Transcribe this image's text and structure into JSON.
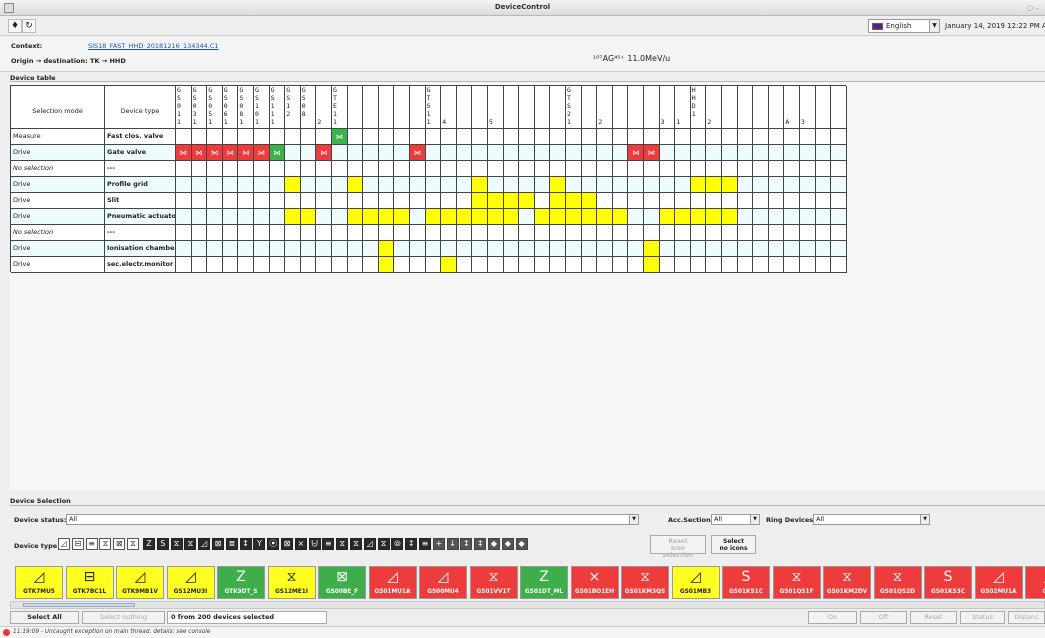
{
  "window": {
    "title": "DeviceControl"
  },
  "toolbar": {
    "language": "English",
    "datetime": "January 14, 2019 12:22 PM  Al"
  },
  "context": {
    "context_label": "Context:",
    "context_value": "SIS18_FAST_HHD_20181216_134344.C1",
    "origin_label": "Origin → destination: TK → HHD",
    "beam": "¹⁰⁷AG⁴⁵⁺ 11.0MeV/u"
  },
  "device_table": {
    "section_title": "Device table",
    "header": {
      "selection_mode": "Selection mode",
      "device_type": "Device type"
    },
    "columns": [
      "G\nS\n0\n1\n1",
      "G\nS\n0\n3\n1",
      "G\nS\n0\n5\n1",
      "G\nS\n0\n6\n1",
      "G\nS\n0\n8\n1",
      "G\nS\n1\n0\n1",
      "G\nS\n1\n1\n1",
      "G\nS\n1\n2",
      "G\nS\n0\n8",
      "\n\n\n\n2",
      "G\nT\nE\n1\n1",
      "",
      "",
      "",
      "",
      "",
      "G\nT\nS\n1\n1",
      "\n\n\n\n4",
      "",
      "",
      "\n\n\n\n5",
      "",
      "",
      "",
      "",
      "G\nT\nS\n2\n1",
      "",
      "\n\n\n\n2",
      "",
      "",
      "",
      "\n\n\n\n3",
      "\n\n\n\n1",
      "H\nH\nD\n1",
      "\n\n\n\n2",
      "",
      "",
      "",
      "",
      "\n\n\n\nA",
      "\n\n\n\n3",
      "",
      ""
    ],
    "rows": [
      {
        "mode": "Measure",
        "mode_italic": false,
        "device_type": "Fast clos. valve",
        "bg": "white",
        "cells": {
          "10": "green"
        }
      },
      {
        "mode": "Drive",
        "mode_italic": false,
        "device_type": "Gate valve",
        "bg": "lblue",
        "cells": {
          "0": "red",
          "1": "red",
          "2": "red",
          "3": "red",
          "4": "red",
          "5": "red",
          "6": "green",
          "9": "red",
          "15": "red",
          "29": "red",
          "30": "red"
        }
      },
      {
        "mode": "No selection",
        "mode_italic": true,
        "device_type": "---",
        "bg": "white",
        "cells": {}
      },
      {
        "mode": "Drive",
        "mode_italic": false,
        "device_type": "Profile grid",
        "bg": "lblue",
        "cells": {
          "7": "yellow",
          "11": "yellow",
          "19": "yellow",
          "24": "yellow",
          "33": "yellow",
          "34": "yellow",
          "35": "yellow"
        }
      },
      {
        "mode": "Drive",
        "mode_italic": false,
        "device_type": "Slit",
        "bg": "white",
        "cells": {
          "19": "yellow",
          "20": "yellow",
          "21": "yellow",
          "22": "yellow",
          "24": "yellow",
          "25": "yellow",
          "26": "yellow"
        }
      },
      {
        "mode": "Drive",
        "mode_italic": false,
        "device_type": "Pneumatic actuator",
        "bg": "lblue",
        "cells": {
          "7": "yellow",
          "8": "yellow",
          "11": "yellow",
          "12": "yellow",
          "13": "yellow",
          "14": "yellow",
          "16": "yellow",
          "17": "yellow",
          "18": "yellow",
          "19": "yellow",
          "20": "yellow",
          "21": "yellow",
          "23": "yellow",
          "24": "yellow",
          "25": "yellow",
          "26": "yellow",
          "27": "yellow",
          "28": "yellow",
          "31": "yellow",
          "32": "yellow",
          "33": "yellow",
          "34": "yellow",
          "35": "yellow"
        }
      },
      {
        "mode": "No selection",
        "mode_italic": true,
        "device_type": "---",
        "bg": "white",
        "cells": {}
      },
      {
        "mode": "Drive",
        "mode_italic": false,
        "device_type": "Ionisation chamber",
        "bg": "lblue",
        "cells": {
          "13": "yellow",
          "30": "yellow"
        }
      },
      {
        "mode": "Drive",
        "mode_italic": false,
        "device_type": "sec.electr.monitor",
        "bg": "white",
        "cells": {
          "13": "yellow",
          "17": "yellow",
          "30": "yellow"
        }
      }
    ]
  },
  "device_selection": {
    "section_title": "Device Selection",
    "device_status_label": "Device status:",
    "device_status_value": "All",
    "acc_section_label": "Acc.Section:",
    "acc_section_value": "All",
    "ring_devices_label": "Ring Devices:",
    "ring_devices_value": "All",
    "device_type_label": "Device type:",
    "reset_icon_selection": "Reset\nicon selection",
    "select_no_icons": "Select\nno icons",
    "type_icons": [
      {
        "glyph": "◿",
        "style": "plain"
      },
      {
        "glyph": "⊟",
        "style": "plain"
      },
      {
        "glyph": "≡",
        "style": "plain"
      },
      {
        "glyph": "⧖",
        "style": "plain"
      },
      {
        "glyph": "⊠",
        "style": "plain"
      },
      {
        "glyph": "⧖",
        "style": "plain"
      },
      {
        "glyph": "Z",
        "style": "dark"
      },
      {
        "glyph": "S",
        "style": "dark"
      },
      {
        "glyph": "⧖",
        "style": "dark"
      },
      {
        "glyph": "⧖",
        "style": "dark"
      },
      {
        "glyph": "◿",
        "style": "dark"
      },
      {
        "glyph": "⊠",
        "style": "dark"
      },
      {
        "glyph": "≣",
        "style": "dark"
      },
      {
        "glyph": "↕",
        "style": "dark"
      },
      {
        "glyph": "Y",
        "style": "dark"
      },
      {
        "glyph": "⦿",
        "style": "dark"
      },
      {
        "glyph": "⊠",
        "style": "dark"
      },
      {
        "glyph": "⨯",
        "style": "dark"
      },
      {
        "glyph": "⨄",
        "style": "dark"
      },
      {
        "glyph": "≡",
        "style": "dark"
      },
      {
        "glyph": "⧖",
        "style": "dark"
      },
      {
        "glyph": "⧖",
        "style": "dark"
      },
      {
        "glyph": "◿",
        "style": "dark"
      },
      {
        "glyph": "⧖",
        "style": "dark"
      },
      {
        "glyph": "⦾",
        "style": "dark"
      },
      {
        "glyph": "↕",
        "style": "dark"
      },
      {
        "glyph": "≡",
        "style": "dark"
      },
      {
        "glyph": "+",
        "style": "dark2"
      },
      {
        "glyph": "↓",
        "style": "dark2"
      },
      {
        "glyph": "↕",
        "style": "dark2"
      },
      {
        "glyph": "‡",
        "style": "dark2"
      },
      {
        "glyph": "◆",
        "style": "dark2"
      },
      {
        "glyph": "◆",
        "style": "dark2"
      },
      {
        "glyph": "◆",
        "style": "dark2"
      }
    ],
    "devices": [
      {
        "name": "GTK7MU5",
        "color": "yellow",
        "icon": "◿"
      },
      {
        "name": "GTK7BC1L",
        "color": "yellow",
        "icon": "⊟"
      },
      {
        "name": "GTK9MB1V",
        "color": "yellow",
        "icon": "◿"
      },
      {
        "name": "GS12MU3I",
        "color": "yellow",
        "icon": "◿"
      },
      {
        "name": "GTK9DT_S",
        "color": "green",
        "icon": "Z"
      },
      {
        "name": "GS12ME1I",
        "color": "yellow",
        "icon": "⧖"
      },
      {
        "name": "GS00BE_F",
        "color": "green",
        "icon": "⊠"
      },
      {
        "name": "GS01MU1A",
        "color": "red",
        "icon": "◿"
      },
      {
        "name": "GS00MU4",
        "color": "red",
        "icon": "◿"
      },
      {
        "name": "GS01VV1T",
        "color": "red",
        "icon": "⧖"
      },
      {
        "name": "GS01DT_ML",
        "color": "green",
        "icon": "Z"
      },
      {
        "name": "GS01BO1EH",
        "color": "red",
        "icon": "⨯"
      },
      {
        "name": "GS01KM3QS",
        "color": "red",
        "icon": "⧖"
      },
      {
        "name": "GS01MB3",
        "color": "yellow",
        "icon": "◿"
      },
      {
        "name": "GS01KS1C",
        "color": "red",
        "icon": "S"
      },
      {
        "name": "GS01QS1F",
        "color": "red",
        "icon": "⧖"
      },
      {
        "name": "GS01KM2DV",
        "color": "red",
        "icon": "⧖"
      },
      {
        "name": "GS01QS2D",
        "color": "red",
        "icon": "⧖"
      },
      {
        "name": "GS01KS3C",
        "color": "red",
        "icon": "S"
      },
      {
        "name": "GS02MU1A",
        "color": "red",
        "icon": "◿"
      },
      {
        "name": "GS0",
        "color": "red",
        "icon": "◿"
      }
    ],
    "select_all": "Select All",
    "select_nothing": "Select nothing",
    "selection_info": "0 from 200 devices selected",
    "actions": [
      "On",
      "Off",
      "Reset",
      "Status",
      "Distanc"
    ]
  },
  "statusbar": {
    "message": "11:19:09 - Uncaught exception on main thread. details: see console"
  },
  "colors": {
    "red": "#ee3b3b",
    "green": "#3bb34a",
    "yellow": "#ffff00",
    "link": "#1a55c8"
  }
}
